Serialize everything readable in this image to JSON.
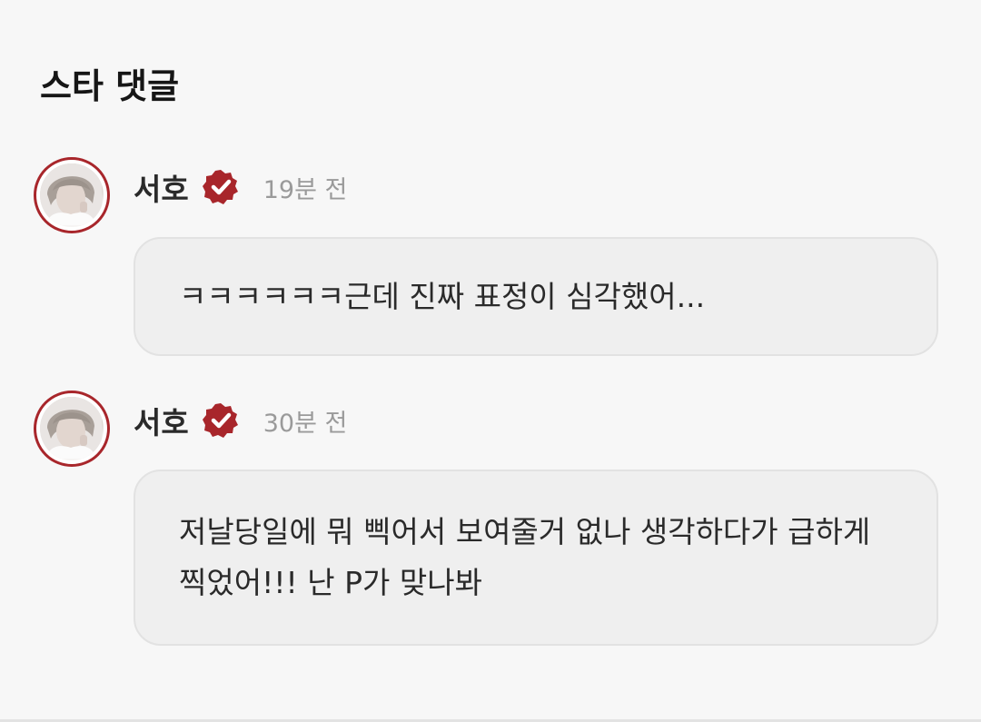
{
  "section": {
    "title": "스타 댓글"
  },
  "colors": {
    "accent": "#a8262b",
    "background": "#f7f7f7",
    "bubble": "#efefef",
    "timestamp": "#9a9a9a"
  },
  "comments": [
    {
      "author": "서호",
      "verified_icon": "verified-badge-icon",
      "time": "19분 전",
      "text": "ㅋㅋㅋㅋㅋㅋ근데 진짜 표정이 심각했어..."
    },
    {
      "author": "서호",
      "verified_icon": "verified-badge-icon",
      "time": "30분 전",
      "text": "저날당일에 뭐 삑어서 보여줄거 없나 생각하다가 급하게 찍었어!!! 난 P가 맞나봐"
    }
  ]
}
